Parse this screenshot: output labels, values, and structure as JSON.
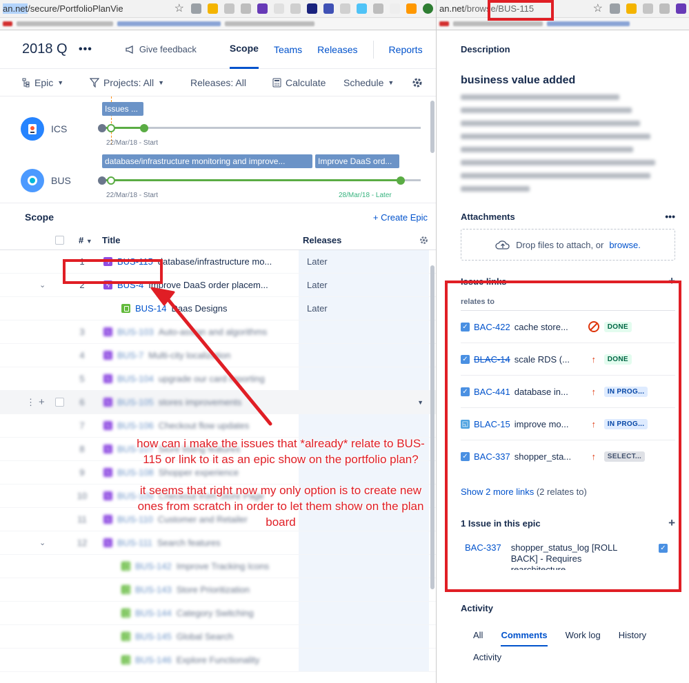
{
  "left_browser": {
    "url_selected": "an.net",
    "url_rest": "/secure/PortfolioPlanVie"
  },
  "right_browser": {
    "url_host": "an.net",
    "url_path": "/browse/BUS-115"
  },
  "plan": {
    "title": "2018 Q",
    "more": "•••",
    "feedback": "Give feedback",
    "tabs": [
      "Scope",
      "Teams",
      "Releases",
      "Reports"
    ],
    "toolbar": {
      "hierarchy": "Epic",
      "projects": "Projects: All",
      "releases": "Releases: All",
      "calculate": "Calculate",
      "schedule": "Schedule"
    }
  },
  "timeline": {
    "projects": [
      {
        "name": "ICS",
        "bars": [
          "Issues ..."
        ],
        "date_start": "22/Mar/18 - Start",
        "date_end": ""
      },
      {
        "name": "BUS",
        "bars": [
          "database/infrastructure monitoring and improve...",
          "Improve DaaS ord..."
        ],
        "date_start": "22/Mar/18 - Start",
        "date_end": "28/Mar/18 - Later"
      }
    ]
  },
  "scope": {
    "label": "Scope",
    "create_epic": "+ Create Epic",
    "col_num": "#",
    "col_title": "Title",
    "col_releases": "Releases",
    "rows": [
      {
        "num": "1",
        "key": "BUS-115",
        "title": "database/infrastructure mo...",
        "release": "Later"
      },
      {
        "num": "2",
        "key": "BUS-4",
        "title": "Improve DaaS order placem...",
        "release": "Later"
      },
      {
        "num": "",
        "key": "BUS-14",
        "title": "Daas Designs",
        "release": "Later"
      },
      {
        "num": "3",
        "key": "BUS-103",
        "title": "Auto-assign and algorithms",
        "release": ""
      },
      {
        "num": "4",
        "key": "BUS-7",
        "title": "Multi-city localization",
        "release": ""
      },
      {
        "num": "5",
        "key": "BUS-104",
        "title": "upgrade our card reporting",
        "release": ""
      },
      {
        "num": "6",
        "key": "BUS-105",
        "title": "stores improvements",
        "release": ""
      },
      {
        "num": "7",
        "key": "BUS-106",
        "title": "Checkout flow updates",
        "release": ""
      },
      {
        "num": "8",
        "key": "BUS-107",
        "title": "Store listing features",
        "release": ""
      },
      {
        "num": "9",
        "key": "BUS-108",
        "title": "Shopper experience",
        "release": ""
      },
      {
        "num": "10",
        "key": "BUS-109",
        "title": "Checkout from Store Page",
        "release": ""
      },
      {
        "num": "11",
        "key": "BUS-110",
        "title": "Customer and Retailer",
        "release": ""
      },
      {
        "num": "12",
        "key": "BUS-111",
        "title": "Search features",
        "release": ""
      },
      {
        "num": "",
        "key": "BUS-142",
        "title": "Improve Tracking Icons",
        "release": ""
      },
      {
        "num": "",
        "key": "BUS-143",
        "title": "Store Prioritization",
        "release": ""
      },
      {
        "num": "",
        "key": "BUS-144",
        "title": "Category Switching",
        "release": ""
      },
      {
        "num": "",
        "key": "BUS-145",
        "title": "Global Search",
        "release": ""
      },
      {
        "num": "",
        "key": "BUS-146",
        "title": "Explore Functionality",
        "release": ""
      }
    ]
  },
  "callout": {
    "q1": "how can i make the issues that *already* relate to BUS-115 or link to it as an epic show on the portfolio plan?",
    "q2": "it seems that right now my only option is to create new ones from scratch in order to let them show on the plan board"
  },
  "issue": {
    "description_label": "Description",
    "description_title": "business value added",
    "attachments_label": "Attachments",
    "attachments_more": "•••",
    "drop_text": "Drop files to attach, or",
    "browse": "browse.",
    "issue_links_label": "Issue links",
    "relates_to": "relates to",
    "links": [
      {
        "key": "BAC-422",
        "summary": "cache store...",
        "status": "DONE",
        "kind": "done",
        "strike": false
      },
      {
        "key": "BLAC-14",
        "summary": "scale RDS (...",
        "status": "DONE",
        "kind": "done",
        "strike": true
      },
      {
        "key": "BAC-441",
        "summary": "database in...",
        "status": "IN PROG...",
        "kind": "prog",
        "strike": false
      },
      {
        "key": "BLAC-15",
        "summary": "improve mo...",
        "status": "IN PROG...",
        "kind": "prog",
        "strike": false
      },
      {
        "key": "BAC-337",
        "summary": "shopper_sta...",
        "status": "SELECT...",
        "kind": "sel",
        "strike": false
      }
    ],
    "show_more": "Show 2 more links",
    "show_more_note": "(2 relates to)",
    "epic_label": "1 Issue in this epic",
    "epic_issue_key": "BAC-337",
    "epic_issue_summary": "shopper_status_log [ROLL BACK] - Requires rearchitecture",
    "activity_label": "Activity",
    "activity_tabs": [
      "All",
      "Comments",
      "Work log",
      "History",
      "Activity"
    ]
  },
  "colors": {
    "accent": "#0052cc",
    "annotation_red": "#e01e25",
    "epic_purple": "#904ee2",
    "story_green": "#63ba3c"
  }
}
